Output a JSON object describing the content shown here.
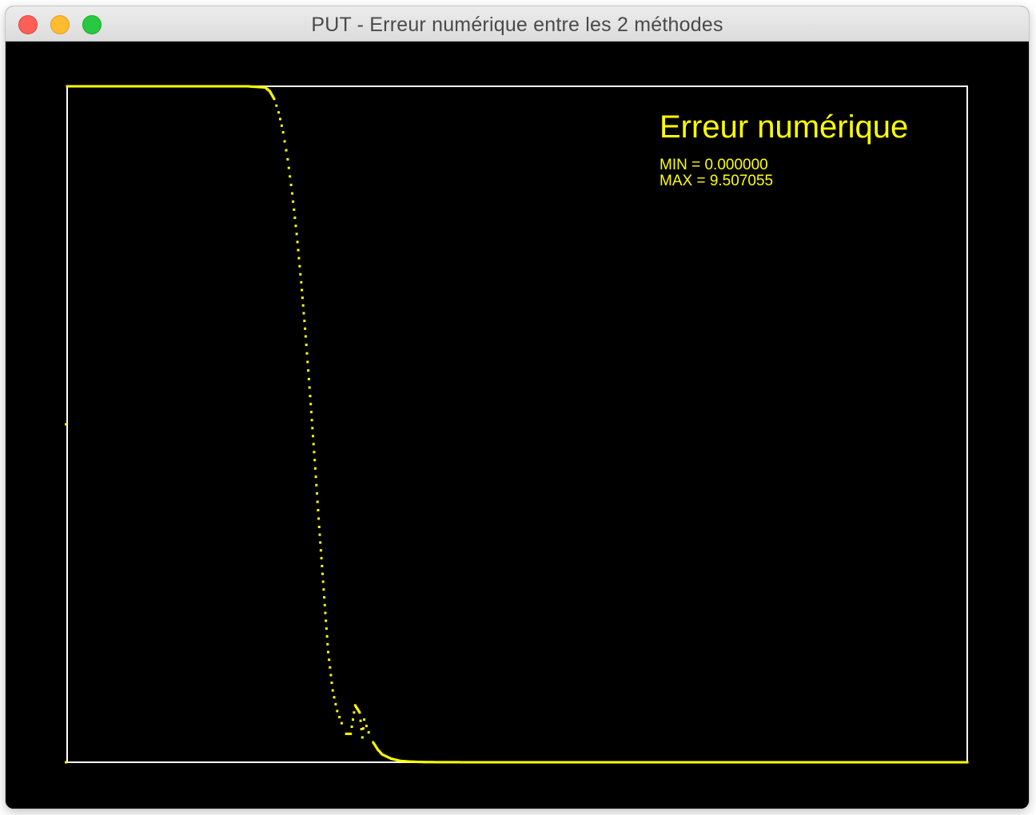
{
  "window": {
    "title": "PUT - Erreur numérique entre les 2 méthodes"
  },
  "plot": {
    "heading": "Erreur numérique",
    "min_label": "MIN = 0.000000",
    "max_label": "MAX = 9.507055",
    "colors": {
      "background": "#000000",
      "frame": "#ffffff",
      "series": "#ffff00"
    }
  },
  "chart_data": {
    "type": "scatter",
    "title": "Erreur numérique",
    "xlabel": "",
    "ylabel": "",
    "xlim": [
      0,
      1
    ],
    "ylim": [
      0,
      9.507055
    ],
    "grid": false,
    "series": [
      {
        "x": [
          0.0,
          0.05,
          0.1,
          0.15,
          0.2,
          0.22,
          0.225,
          0.23,
          0.235,
          0.24,
          0.245,
          0.25,
          0.255,
          0.26,
          0.265,
          0.27,
          0.275,
          0.28,
          0.285,
          0.29,
          0.295,
          0.3,
          0.305,
          0.31,
          0.315,
          0.32,
          0.325,
          0.328,
          0.33,
          0.335,
          0.34,
          0.345,
          0.35,
          0.36,
          0.37,
          0.38,
          0.39,
          0.4,
          0.45,
          0.5,
          0.6,
          0.7,
          0.8,
          0.9,
          1.0
        ],
        "y": [
          9.507,
          9.507,
          9.507,
          9.507,
          9.507,
          9.49,
          9.44,
          9.33,
          9.14,
          8.86,
          8.48,
          8.0,
          7.43,
          6.75,
          5.99,
          5.15,
          4.25,
          3.31,
          2.43,
          1.55,
          1.01,
          0.72,
          0.55,
          0.4,
          0.4,
          0.8,
          0.7,
          0.35,
          0.6,
          0.42,
          0.28,
          0.18,
          0.11,
          0.05,
          0.02,
          0.01,
          0.005,
          0.002,
          0.0,
          0.0,
          0.0,
          0.0,
          0.0,
          0.0,
          0.0
        ]
      }
    ]
  }
}
